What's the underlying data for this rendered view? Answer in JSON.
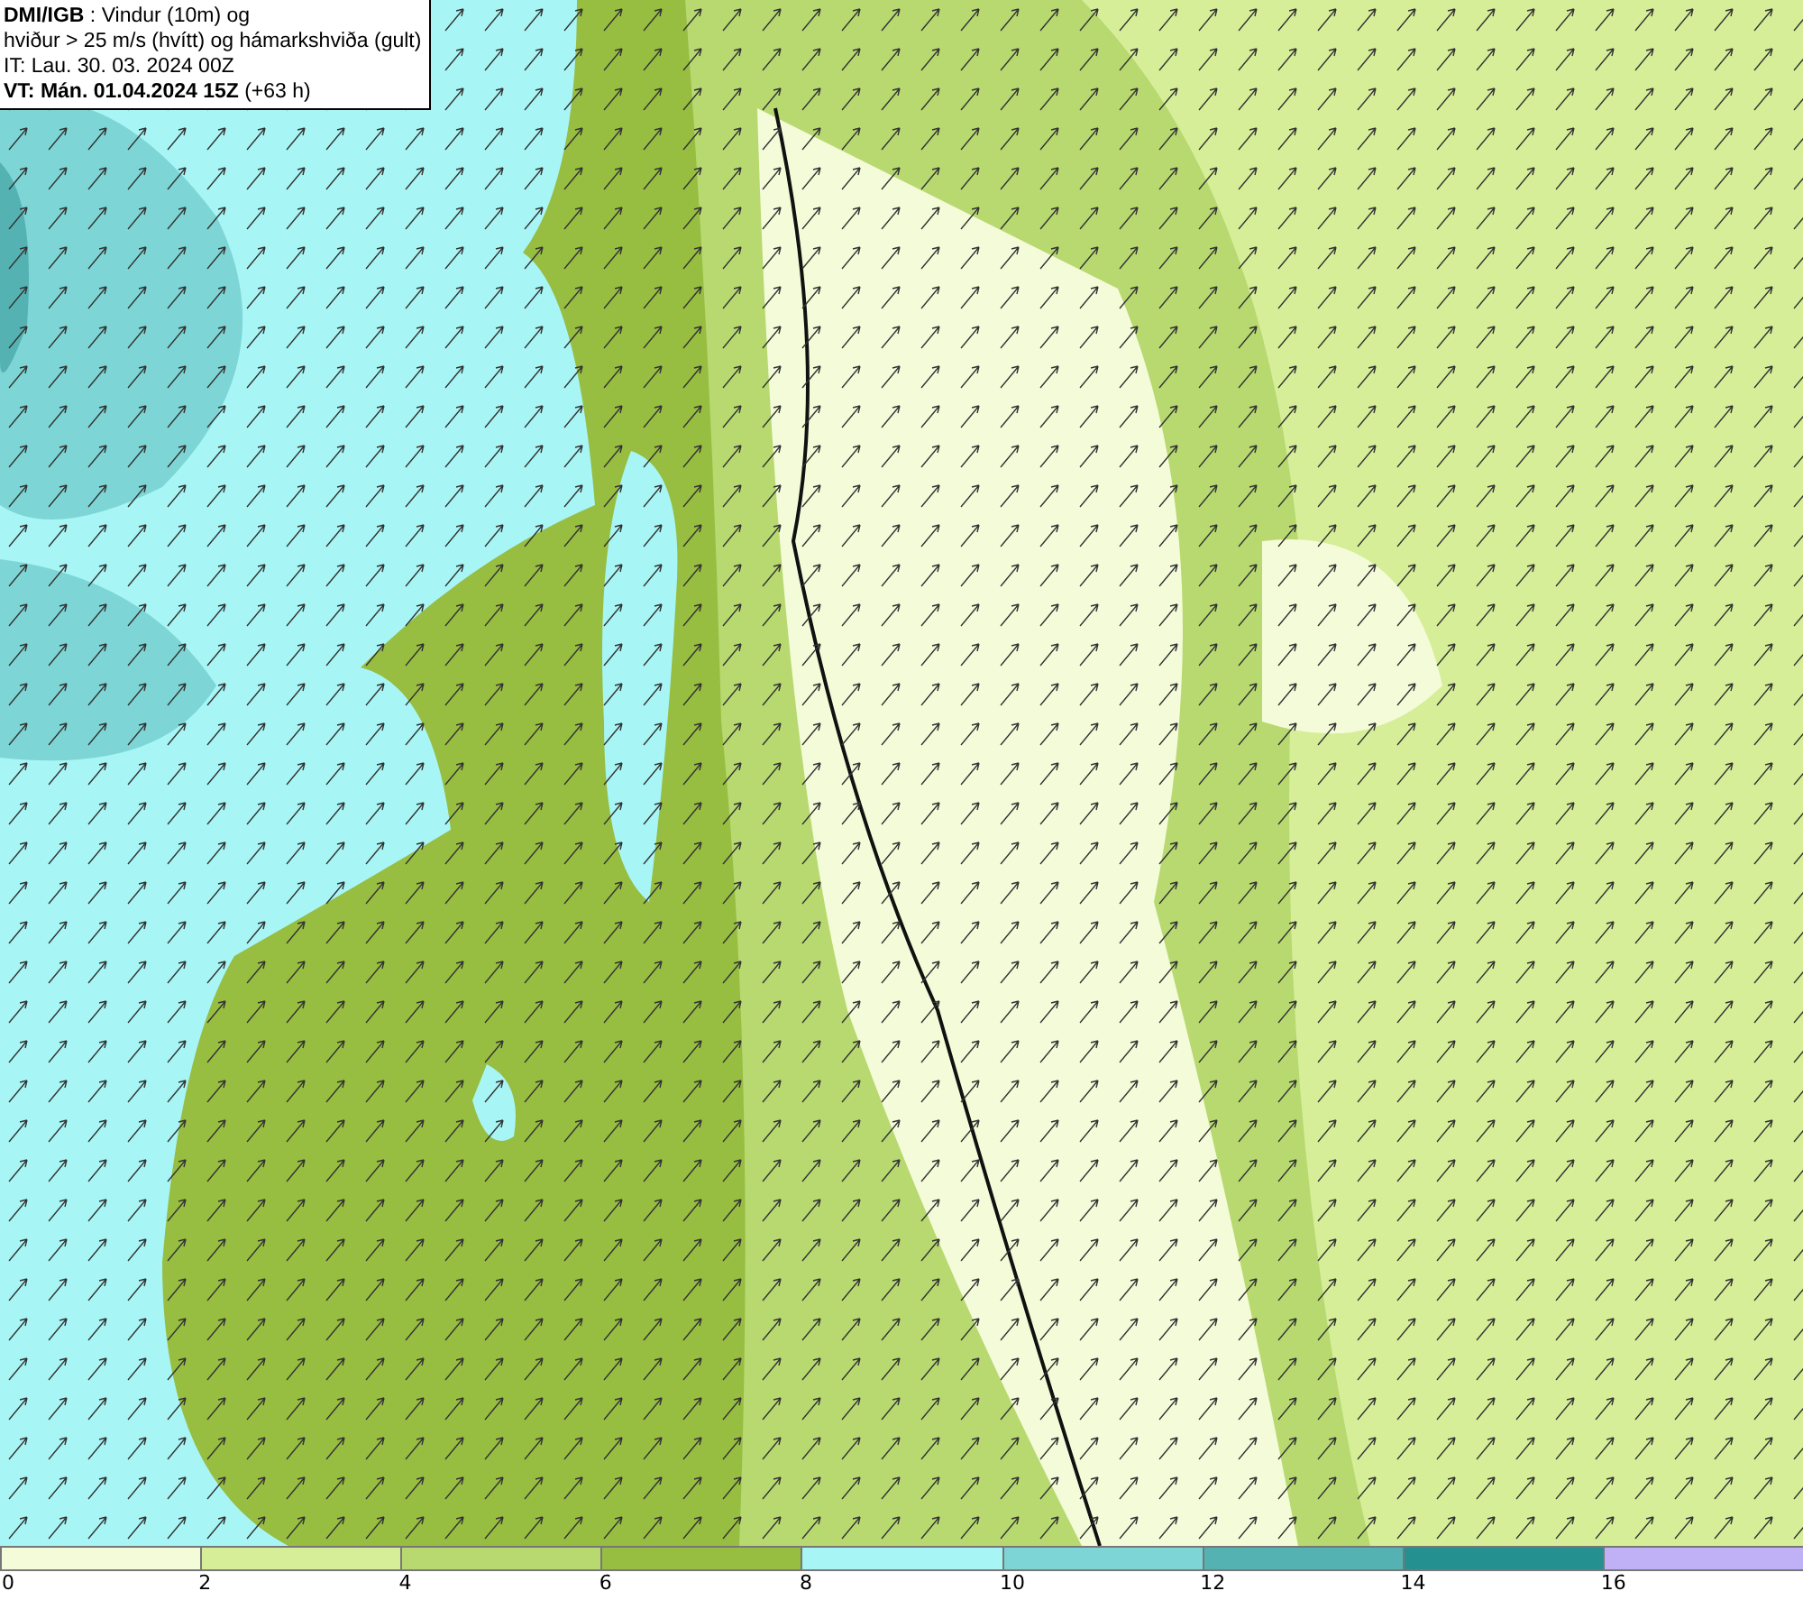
{
  "header": {
    "lines": [
      "**DMI/IGB** : Vindur (10m) og",
      "hviður > 25 m/s (hvítt) og hámarkshviða (gult)",
      "IT: Lau. 30. 03. 2024 00Z",
      "**VT: Mán. 01.04.2024 15Z** (+63 h)"
    ]
  },
  "legend": [
    {
      "label": "0",
      "color": "#f4fbd8"
    },
    {
      "label": "2",
      "color": "#d6ee98"
    },
    {
      "label": "4",
      "color": "#b7d970"
    },
    {
      "label": "6",
      "color": "#97bd41"
    },
    {
      "label": "8",
      "color": "#a8f5f5"
    },
    {
      "label": "10",
      "color": "#7ed5d5"
    },
    {
      "label": "12",
      "color": "#55b2b2"
    },
    {
      "label": "14",
      "color": "#249090"
    },
    {
      "label": "16",
      "color": "#c0b0f5"
    }
  ]
}
